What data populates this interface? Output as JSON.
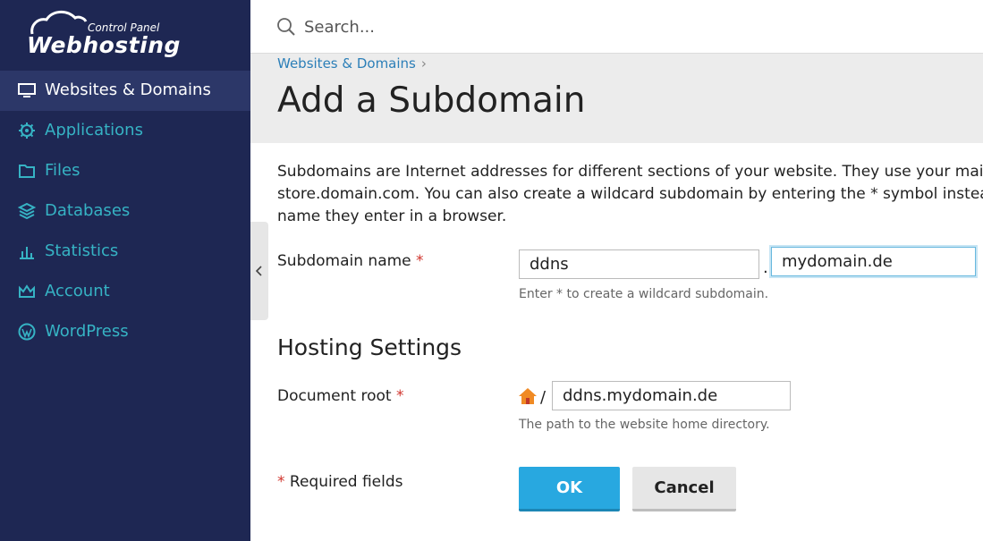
{
  "logo": {
    "subtitle": "Control Panel",
    "title": "Webhosting"
  },
  "sidebar": {
    "items": [
      {
        "label": "Websites & Domains",
        "icon": "monitor-icon",
        "active": true
      },
      {
        "label": "Applications",
        "icon": "gear-icon"
      },
      {
        "label": "Files",
        "icon": "folder-icon"
      },
      {
        "label": "Databases",
        "icon": "layers-icon"
      },
      {
        "label": "Statistics",
        "icon": "bar-chart-icon"
      },
      {
        "label": "Account",
        "icon": "crown-icon"
      },
      {
        "label": "WordPress",
        "icon": "wordpress-icon"
      }
    ]
  },
  "search": {
    "placeholder": "Search..."
  },
  "breadcrumb": {
    "item": "Websites & Domains",
    "separator": "›"
  },
  "page": {
    "title": "Add a Subdomain"
  },
  "description": {
    "line1": "Subdomains are Internet addresses for different sections of your website. They use your main do",
    "line2": "store.domain.com. You can also create a wildcard subdomain by entering the * symbol instead of",
    "line3": "name they enter in a browser."
  },
  "form": {
    "subdomain_label": "Subdomain name",
    "required_mark": "*",
    "subdomain_value": "ddns",
    "dot": ".",
    "domain_value": "mydomain.de",
    "subdomain_hint": "Enter * to create a wildcard subdomain.",
    "hosting_title": "Hosting Settings",
    "docroot_label": "Document root",
    "docroot_slash": "/",
    "docroot_value": "ddns.mydomain.de",
    "docroot_hint": "The path to the website home directory.",
    "required_note": "Required fields"
  },
  "buttons": {
    "ok": "OK",
    "cancel": "Cancel"
  },
  "colors": {
    "sidebar_bg": "#1e2753",
    "accent_link": "#36b3c4",
    "primary_button": "#28a8e0",
    "required": "#d0342c"
  }
}
